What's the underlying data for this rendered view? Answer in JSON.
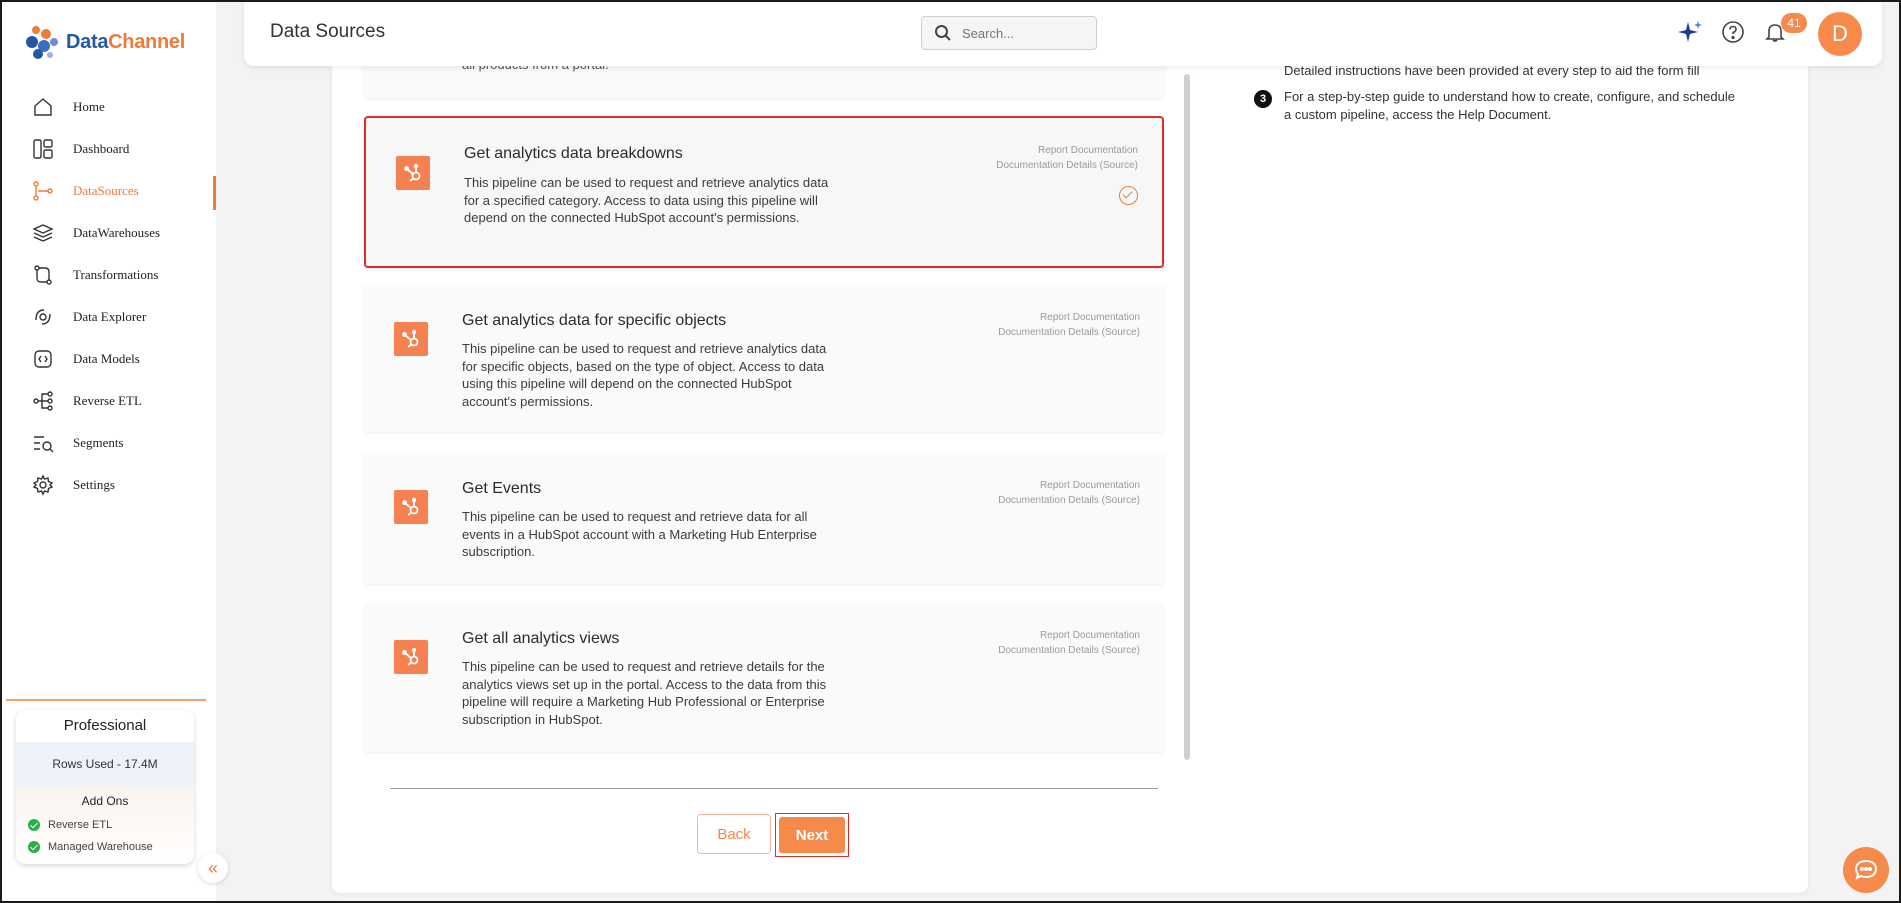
{
  "app": {
    "logo_part1": "Data",
    "logo_part2": "Channel"
  },
  "sidebar": {
    "items": [
      {
        "label": "Home",
        "icon": "home-icon",
        "active": false
      },
      {
        "label": "Dashboard",
        "icon": "dashboard-icon",
        "active": false
      },
      {
        "label": "DataSources",
        "icon": "datasources-icon",
        "active": true
      },
      {
        "label": "DataWarehouses",
        "icon": "layers-icon",
        "active": false
      },
      {
        "label": "Transformations",
        "icon": "transformations-icon",
        "active": false
      },
      {
        "label": "Data Explorer",
        "icon": "explorer-icon",
        "active": false
      },
      {
        "label": "Data Models",
        "icon": "data-models-icon",
        "active": false
      },
      {
        "label": "Reverse ETL",
        "icon": "reverse-etl-icon",
        "active": false
      },
      {
        "label": "Segments",
        "icon": "segments-icon",
        "active": false
      },
      {
        "label": "Settings",
        "icon": "gear-icon",
        "active": false
      }
    ],
    "plan": {
      "title": "Professional",
      "rows_used": "Rows Used - 17.4M",
      "addons_title": "Add Ons",
      "addons": [
        "Reverse ETL",
        "Managed Warehouse"
      ]
    }
  },
  "header": {
    "title": "Data Sources",
    "search_placeholder": "Search...",
    "notifications_count": "41",
    "avatar_initial": "D"
  },
  "pipelines": [
    {
      "title": "",
      "description": "all products from a portal.",
      "links": [],
      "selected": false
    },
    {
      "title": "Get analytics data breakdowns",
      "description": "This pipeline can be used to request and retrieve analytics data for a specified category. Access to data using this pipeline will depend on the connected HubSpot account's permissions.",
      "links": [
        "Report Documentation",
        "Documentation Details (Source)"
      ],
      "selected": true
    },
    {
      "title": "Get analytics data for specific objects",
      "description": "This pipeline can be used to request and retrieve analytics data for specific objects, based on the type of object. Access to data using this pipeline will depend on the connected HubSpot account's permissions.",
      "links": [
        "Report Documentation",
        "Documentation Details (Source)"
      ],
      "selected": false
    },
    {
      "title": "Get Events",
      "description": "This pipeline can be used to request and retrieve data for all events in a HubSpot account with a Marketing Hub Enterprise subscription.",
      "links": [
        "Report Documentation",
        "Documentation Details (Source)"
      ],
      "selected": false
    },
    {
      "title": "Get all analytics views",
      "description": "This pipeline can be used to request and retrieve details for the analytics views set up in the portal. Access to the data from this pipeline will require a Marketing Hub Professional or Enterprise subscription in HubSpot.",
      "links": [
        "Report Documentation",
        "Documentation Details (Source)"
      ],
      "selected": false
    }
  ],
  "buttons": {
    "back": "Back",
    "next": "Next"
  },
  "instructions": {
    "partial_line": "Detailed instructions have been provided at every step to aid the form fill",
    "step_number": "3",
    "step_text": "For a step-by-step guide to understand how to create, configure, and schedule a custom pipeline, access the Help Document."
  },
  "colors": {
    "accent": "#f58a4b",
    "selected_border": "#d9302c",
    "brand_blue": "#2458a6"
  }
}
